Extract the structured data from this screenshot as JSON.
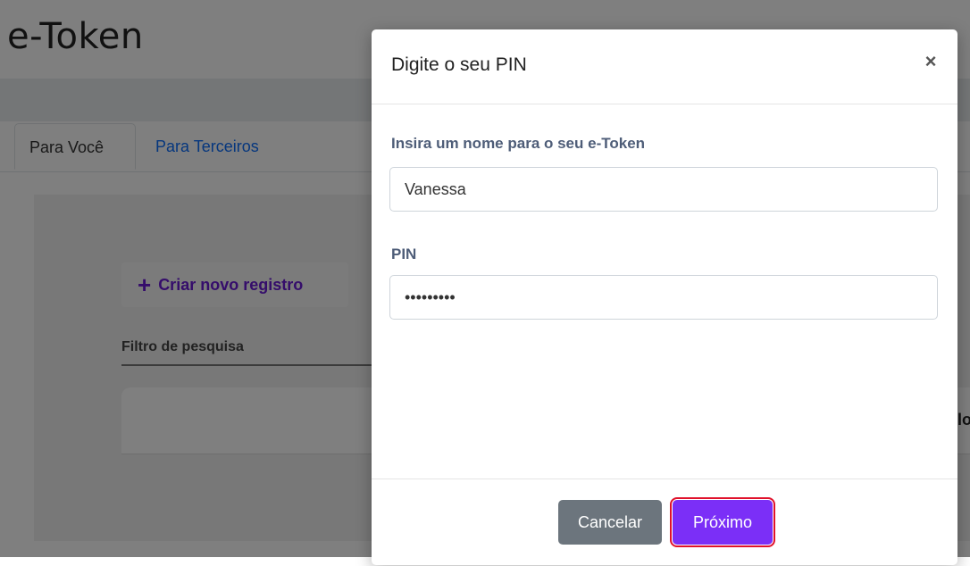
{
  "app": {
    "title": "e-Token",
    "tabs": [
      {
        "label": "Para Você",
        "active": true
      },
      {
        "label": "Para Terceiros",
        "active": false
      }
    ],
    "create_button_label": "Criar novo registro",
    "filter_label": "Filtro de pesquisa",
    "truncated_text": "lo"
  },
  "modal": {
    "title": "Digite o seu PIN",
    "close_symbol": "×",
    "name_field": {
      "label": "Insira um nome para o seu e-Token",
      "value": "Vanessa"
    },
    "pin_field": {
      "label": "PIN",
      "value": "123456789"
    },
    "cancel_label": "Cancelar",
    "next_label": "Próximo"
  },
  "colors": {
    "primary": "#7b2ff7",
    "secondary": "#6c757d",
    "highlight": "#e0112b",
    "link": "#0d6efd"
  },
  "icons": {
    "close": "close-icon",
    "plus": "plus-icon"
  }
}
